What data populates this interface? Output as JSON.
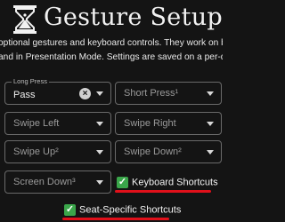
{
  "header": {
    "title": "Gesture Setup",
    "logo_icon": "hourglass-logo-icon"
  },
  "description": {
    "line1": "optional gestures and keyboard controls. They work on both the",
    "line2": "and in Presentation Mode. Settings are saved on a per-device"
  },
  "fields": {
    "long_press": {
      "label": "Long Press",
      "value": "Pass"
    },
    "short_press": {
      "placeholder": "Short Press¹"
    },
    "swipe_left": {
      "placeholder": "Swipe Left"
    },
    "swipe_right": {
      "placeholder": "Swipe Right"
    },
    "swipe_up": {
      "placeholder": "Swipe Up²"
    },
    "swipe_down": {
      "placeholder": "Swipe Down²"
    },
    "screen_down": {
      "placeholder": "Screen Down³"
    }
  },
  "checkboxes": {
    "keyboard_shortcuts": {
      "label": "Keyboard Shortcuts",
      "checked": true
    },
    "seat_specific_shortcuts": {
      "label": "Seat-Specific Shortcuts",
      "checked": true
    }
  },
  "colors": {
    "background": "#141414",
    "checkbox": "#3aa64a",
    "annotation_underline": "#e0101a"
  }
}
